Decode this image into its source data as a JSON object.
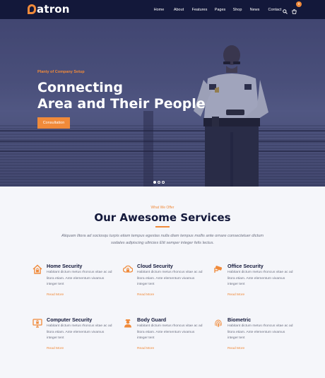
{
  "brand": {
    "logo_text": "atron"
  },
  "nav": {
    "items": [
      {
        "label": "Home"
      },
      {
        "label": "About"
      },
      {
        "label": "Features"
      },
      {
        "label": "Pages"
      },
      {
        "label": "Shop"
      },
      {
        "label": "News"
      },
      {
        "label": "Contact"
      }
    ],
    "icons": [
      "search-icon",
      "cart-icon"
    ],
    "cart_count": "0"
  },
  "hero": {
    "kicker": "Planty of Company Setup",
    "title_line1": "Connecting",
    "title_line2": "Area and Their People",
    "button": "Consultation",
    "slides": 3,
    "active_slide": 1
  },
  "services": {
    "kicker": "What We Offer",
    "title": "Our Awesome Services",
    "intro": "Aliquam litora ad sociosqu turpis etiam tempus egestas nulla diam tempus mollis ante ornare consectetuer dictum sodales adipiscing ultricies Elit semper integer felis lectus.",
    "items": [
      {
        "title": "Home Security",
        "text": "Habitant dictum metus rhoncus vitae ac ad litora etiam. Ante elementum vivamus integer tent",
        "link": "Read More",
        "icon": "house-lock-icon"
      },
      {
        "title": "Cloud Security",
        "text": "Habitant dictum metus rhoncus vitae ac ad litora etiam. Ante elementum vivamus integer tent",
        "link": "Read More",
        "icon": "cloud-lock-icon"
      },
      {
        "title": "Office Security",
        "text": "Habitant dictum metus rhoncus vitae ac ad litora etiam. Ante elementum vivamus integer tent",
        "link": "Read More",
        "icon": "cctv-camera-icon"
      },
      {
        "title": "Computer Security",
        "text": "Habitant dictum metus rhoncus vitae ac ad litora etiam. Ante elementum vivamus integer tent",
        "link": "Read More",
        "icon": "monitor-lock-icon"
      },
      {
        "title": "Body Guard",
        "text": "Habitant dictum metus rhoncus vitae ac ad litora etiam. Ante elementum vivamus integer tent",
        "link": "Read More",
        "icon": "guard-icon"
      },
      {
        "title": "Biometric",
        "text": "Habitant dictum metus rhoncus vitae ac ad litora etiam. Ante elementum vivamus integer tent",
        "link": "Read More",
        "icon": "fingerprint-icon"
      }
    ]
  },
  "colors": {
    "navy": "#13183a",
    "accent": "#f08a3a",
    "hero": "#555b85",
    "background": "#f5f6fa"
  }
}
